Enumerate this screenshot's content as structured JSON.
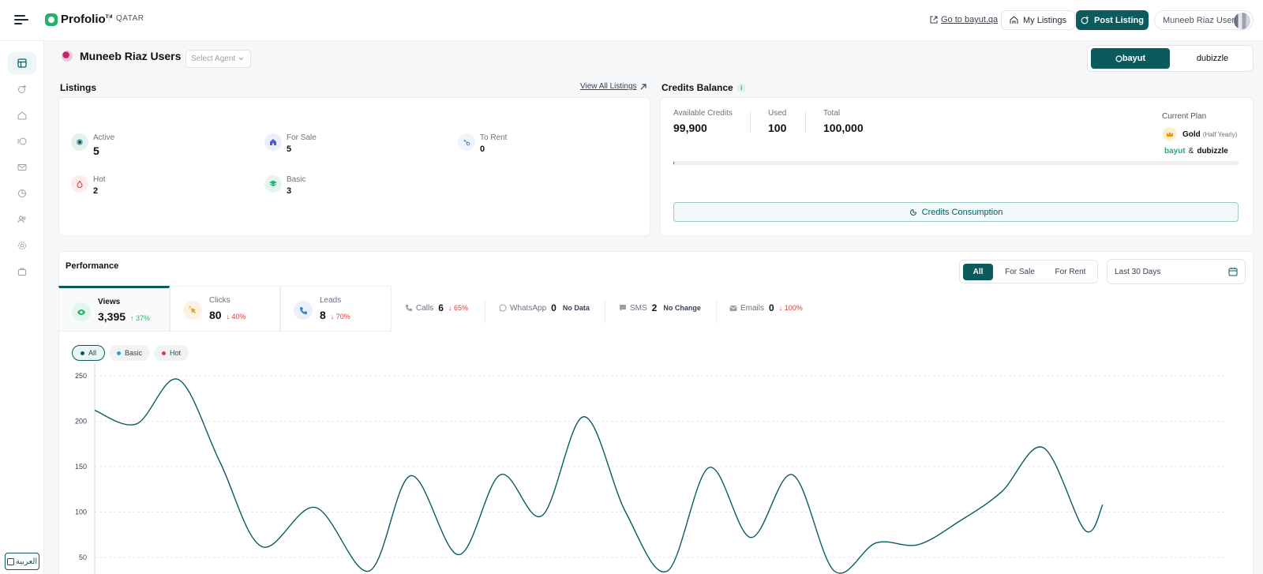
{
  "header": {
    "logo_name": "Profolio",
    "logo_tm": "TM",
    "country": "QATAR",
    "go_link": "Go to bayut.qa",
    "my_listings": "My Listings",
    "post_listing": "Post Listing",
    "user_name": "Muneeb Riaz Users"
  },
  "sidebar": {
    "icons": [
      "dashboard-icon",
      "listing-add-icon",
      "home-building-icon",
      "leads-icon",
      "mail-icon",
      "analytics-icon",
      "users-icon",
      "settings-icon",
      "briefcase-icon"
    ],
    "language": "العربية"
  },
  "agent": {
    "name": "Muneeb Riaz Users",
    "select_placeholder": "Select Agent"
  },
  "brands": {
    "primary": "bayut",
    "secondary": "dubizzle"
  },
  "listings": {
    "title": "Listings",
    "view_all": "View All Listings",
    "items": [
      {
        "label": "Active",
        "value": "5"
      },
      {
        "label": "For Sale",
        "value": "5"
      },
      {
        "label": "To Rent",
        "value": "0"
      },
      {
        "label": "Hot",
        "value": "2"
      },
      {
        "label": "Basic",
        "value": "3"
      }
    ]
  },
  "credits": {
    "title": "Credits Balance",
    "available_label": "Available Credits",
    "available": "99,900",
    "used_label": "Used",
    "used": "100",
    "total_label": "Total",
    "total": "100,000",
    "used_fraction": 0.001,
    "consumption_button": "Credits Consumption",
    "plan_title": "Current Plan",
    "plan_name": "Gold",
    "plan_period": "(Half Yearly)",
    "plan_brand_a": "bayut",
    "plan_amp": "&",
    "plan_brand_b": "dubizzle"
  },
  "performance": {
    "title": "Performance",
    "filters": [
      "All",
      "For Sale",
      "For Rent"
    ],
    "active_filter": "All",
    "date_range": "Last 30 Days",
    "metrics": [
      {
        "label": "Views",
        "value": "3,395",
        "delta": "37%",
        "trend": "up"
      },
      {
        "label": "Clicks",
        "value": "80",
        "delta": "40%",
        "trend": "down"
      },
      {
        "label": "Leads",
        "value": "8",
        "delta": "70%",
        "trend": "down"
      }
    ],
    "inline_metrics": [
      {
        "label": "Calls",
        "value": "6",
        "delta": "65%",
        "trend": "down"
      },
      {
        "label": "WhatsApp",
        "value": "0",
        "note": "No Data"
      },
      {
        "label": "SMS",
        "value": "2",
        "note": "No Change"
      },
      {
        "label": "Emails",
        "value": "0",
        "delta": "100%",
        "trend": "down"
      }
    ],
    "chips": [
      {
        "label": "All",
        "color": "#0b5b5e"
      },
      {
        "label": "Basic",
        "color": "#1aa9c9"
      },
      {
        "label": "Hot",
        "color": "#e53935"
      }
    ],
    "arrow_up": "↑",
    "arrow_down": "↓"
  },
  "chart_data": {
    "type": "line",
    "title": "",
    "xlabel": "",
    "ylabel": "",
    "yticks": [
      "250",
      "200",
      "150",
      "100",
      "50"
    ],
    "ylim": [
      30,
      260
    ],
    "grid": true,
    "color": "#0b5b5e",
    "x": [
      1,
      4,
      8,
      12,
      17,
      22,
      27,
      32,
      36,
      40,
      44,
      48,
      52,
      56,
      60,
      64,
      67,
      70,
      73,
      76
    ],
    "series": [
      {
        "values": [
          212,
          197,
          246,
          155,
          62,
          105,
          35,
          140,
          53,
          141,
          96,
          205,
          100,
          35,
          149,
          72,
          141,
          35,
          66,
          110
        ]
      },
      {
        "values": []
      }
    ],
    "series_points": [
      [
        0,
        212
      ],
      [
        7,
        197
      ],
      [
        14,
        246
      ],
      [
        21,
        155
      ],
      [
        28,
        62
      ],
      [
        37,
        105
      ],
      [
        46,
        35
      ],
      [
        53,
        140
      ],
      [
        61,
        53
      ],
      [
        68,
        141
      ],
      [
        75,
        96
      ],
      [
        82,
        205
      ],
      [
        89,
        100
      ],
      [
        96,
        35
      ],
      [
        103,
        149
      ],
      [
        110,
        72
      ],
      [
        117,
        141
      ],
      [
        124,
        35
      ],
      [
        131,
        66
      ],
      [
        138,
        64
      ],
      [
        145,
        90
      ],
      [
        152,
        122
      ],
      [
        159,
        171
      ],
      [
        166,
        80
      ],
      [
        169,
        108
      ]
    ]
  }
}
